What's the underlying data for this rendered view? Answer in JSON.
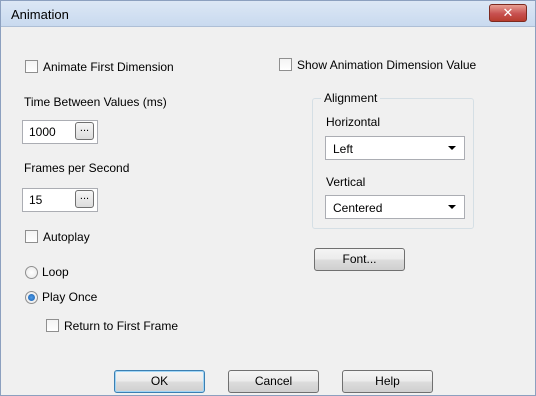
{
  "window": {
    "title": "Animation",
    "close_symbol": "✕"
  },
  "options": {
    "animate_first_dimension": {
      "label": "Animate First Dimension",
      "checked": false
    },
    "show_animation_dimension_value": {
      "label": "Show Animation Dimension Value",
      "checked": false
    },
    "autoplay": {
      "label": "Autoplay",
      "checked": false
    },
    "return_to_first_frame": {
      "label": "Return to First Frame",
      "checked": false
    }
  },
  "time_between_values": {
    "label": "Time Between Values (ms)",
    "value": "1000",
    "button": "..."
  },
  "frames_per_second": {
    "label": "Frames per Second",
    "value": "15",
    "button": "..."
  },
  "playback": {
    "loop": {
      "label": "Loop",
      "selected": false
    },
    "play_once": {
      "label": "Play Once",
      "selected": true
    }
  },
  "alignment": {
    "title": "Alignment",
    "horizontal": {
      "label": "Horizontal",
      "value": "Left"
    },
    "vertical": {
      "label": "Vertical",
      "value": "Centered"
    }
  },
  "buttons": {
    "font": "Font...",
    "ok": "OK",
    "cancel": "Cancel",
    "help": "Help"
  }
}
